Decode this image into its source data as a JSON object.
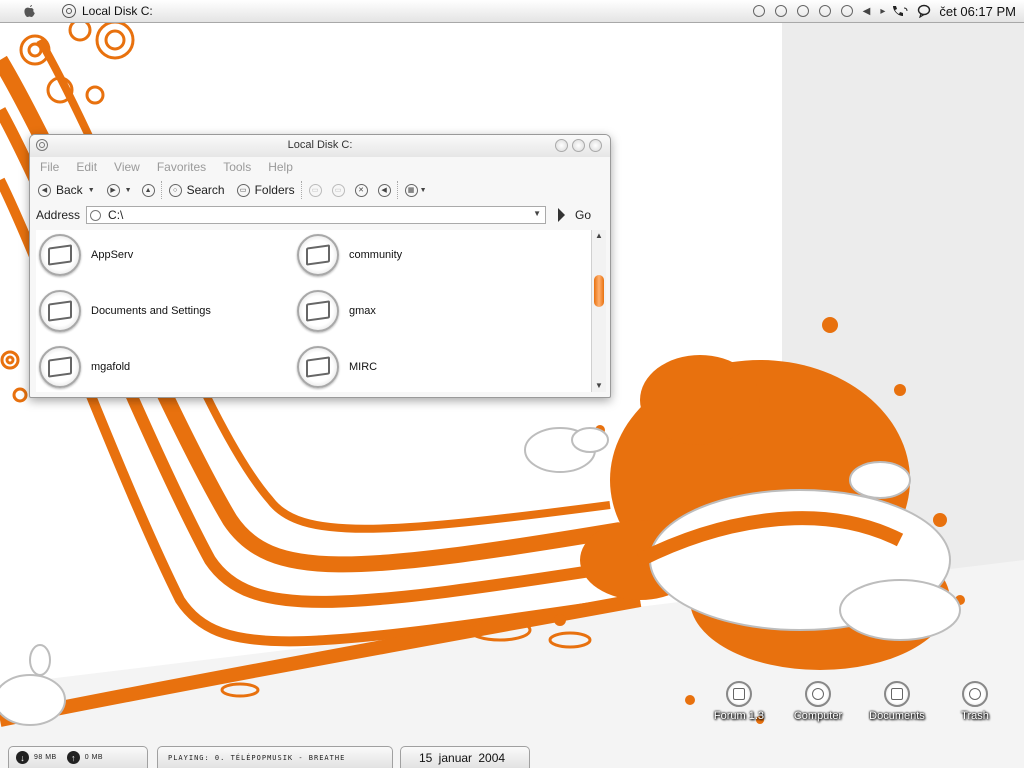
{
  "menubar": {
    "app_title": "Local Disk C:",
    "clock": "čet 06:17 PM",
    "tray_icons": [
      "home-icon",
      "network-icon",
      "security-icon",
      "sound-icon",
      "shield-icon",
      "back-icon",
      "forward-icon"
    ]
  },
  "window": {
    "title": "Local Disk C:",
    "menu": [
      "File",
      "Edit",
      "View",
      "Favorites",
      "Tools",
      "Help"
    ],
    "toolbar": {
      "back_label": "Back",
      "search_label": "Search",
      "folders_label": "Folders"
    },
    "address": {
      "label": "Address",
      "value": "C:\\",
      "go_label": "Go"
    },
    "folders": [
      {
        "name": "AppServ"
      },
      {
        "name": "community"
      },
      {
        "name": "Documents and Settings"
      },
      {
        "name": "gmax"
      },
      {
        "name": "mgafold"
      },
      {
        "name": "MIRC"
      }
    ]
  },
  "desktop_icons": [
    {
      "label": "Forum 1.3"
    },
    {
      "label": "Computer"
    },
    {
      "label": "Documents"
    },
    {
      "label": "Trash"
    }
  ],
  "taskbar": {
    "download": "98 MB",
    "upload": "0 MB",
    "now_playing": "PLAYING: 0. TÉLÉPOPMUSIK - BREATHE",
    "date": "15 januar 2004"
  },
  "colors": {
    "accent": "#e8710e",
    "menubar": "#ececec",
    "window_bg": "#f7f7f7"
  }
}
